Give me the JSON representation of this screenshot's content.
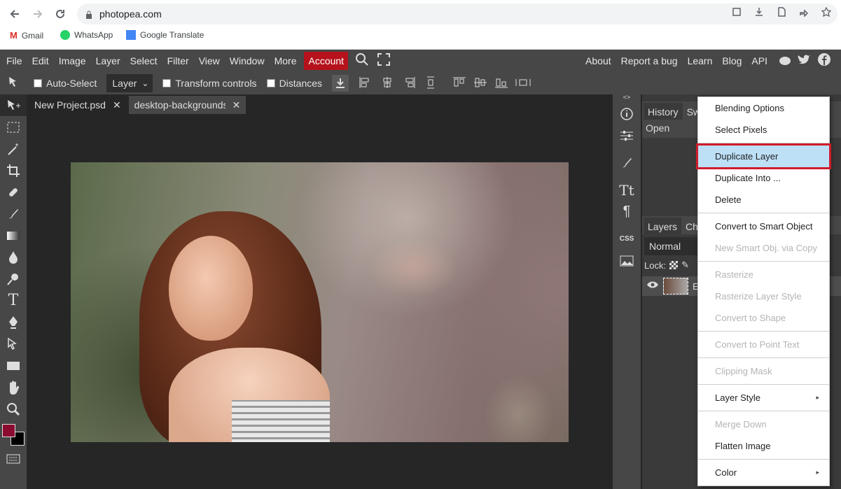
{
  "browser": {
    "url": "photopea.com",
    "bookmarks": [
      "Gmail",
      "WhatsApp",
      "Google Translate"
    ]
  },
  "menu": {
    "items": [
      "File",
      "Edit",
      "Image",
      "Layer",
      "Select",
      "Filter",
      "View",
      "Window",
      "More"
    ],
    "account": "Account",
    "right": [
      "About",
      "Report a bug",
      "Learn",
      "Blog",
      "API"
    ]
  },
  "toolbar": {
    "auto_select": "Auto-Select",
    "layer": "Layer",
    "transform": "Transform controls",
    "distances": "Distances"
  },
  "tabs": [
    {
      "label": "New Project.psd"
    },
    {
      "label": "desktop-backgrounds"
    }
  ],
  "history": {
    "tab": "History",
    "tab2": "Sw",
    "item": "Open"
  },
  "layers": {
    "tab": "Layers",
    "tab2": "Ch",
    "blend": "Normal",
    "lock": "Lock:",
    "layer_initial": "E"
  },
  "colors": {
    "accent": "#b5121b",
    "highlight": "#bde0f7",
    "highlight_border": "#d01c2c",
    "fg_color": "#8b0a30"
  },
  "context_menu": [
    {
      "label": "Blending Options",
      "disabled": false
    },
    {
      "label": "Select Pixels",
      "disabled": false
    },
    {
      "sep": true
    },
    {
      "label": "Duplicate Layer",
      "disabled": false,
      "highlight": true
    },
    {
      "label": "Duplicate Into ...",
      "disabled": false
    },
    {
      "label": "Delete",
      "disabled": false
    },
    {
      "sep": true
    },
    {
      "label": "Convert to Smart Object",
      "disabled": false
    },
    {
      "label": "New Smart Obj. via Copy",
      "disabled": true
    },
    {
      "sep": true
    },
    {
      "label": "Rasterize",
      "disabled": true
    },
    {
      "label": "Rasterize Layer Style",
      "disabled": true
    },
    {
      "label": "Convert to Shape",
      "disabled": true
    },
    {
      "sep": true
    },
    {
      "label": "Convert to Point Text",
      "disabled": true
    },
    {
      "sep": true
    },
    {
      "label": "Clipping Mask",
      "disabled": true
    },
    {
      "sep": true
    },
    {
      "label": "Layer Style",
      "disabled": false,
      "submenu": true
    },
    {
      "sep": true
    },
    {
      "label": "Merge Down",
      "disabled": true
    },
    {
      "label": "Flatten Image",
      "disabled": false
    },
    {
      "sep": true
    },
    {
      "label": "Color",
      "disabled": false,
      "submenu": true
    }
  ]
}
